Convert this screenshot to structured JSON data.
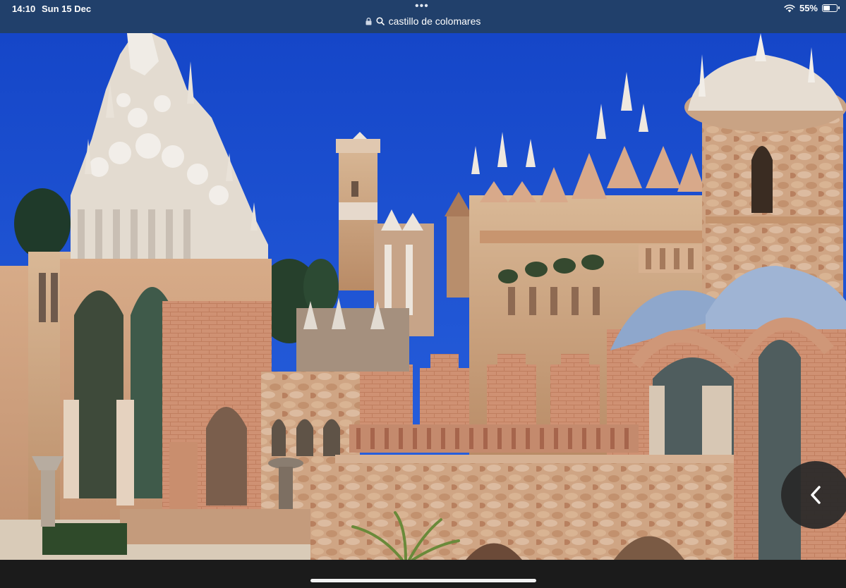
{
  "status_bar": {
    "time": "14:10",
    "date": "Sun 15 Dec",
    "battery_percent": "55%",
    "battery_level": 0.55,
    "icons": [
      "wifi-icon",
      "battery-icon",
      "more-dots-icon"
    ]
  },
  "address_bar": {
    "url": "castillo de colomares",
    "icons": [
      "lock-icon",
      "search-icon"
    ]
  },
  "photo": {
    "subject": "castle-photo"
  },
  "controls": {
    "back_icon": "chevron-left-icon"
  },
  "colors": {
    "status_bar_bg": "#21406b",
    "sky": "#1d52d6",
    "stone": "#c49a78"
  }
}
